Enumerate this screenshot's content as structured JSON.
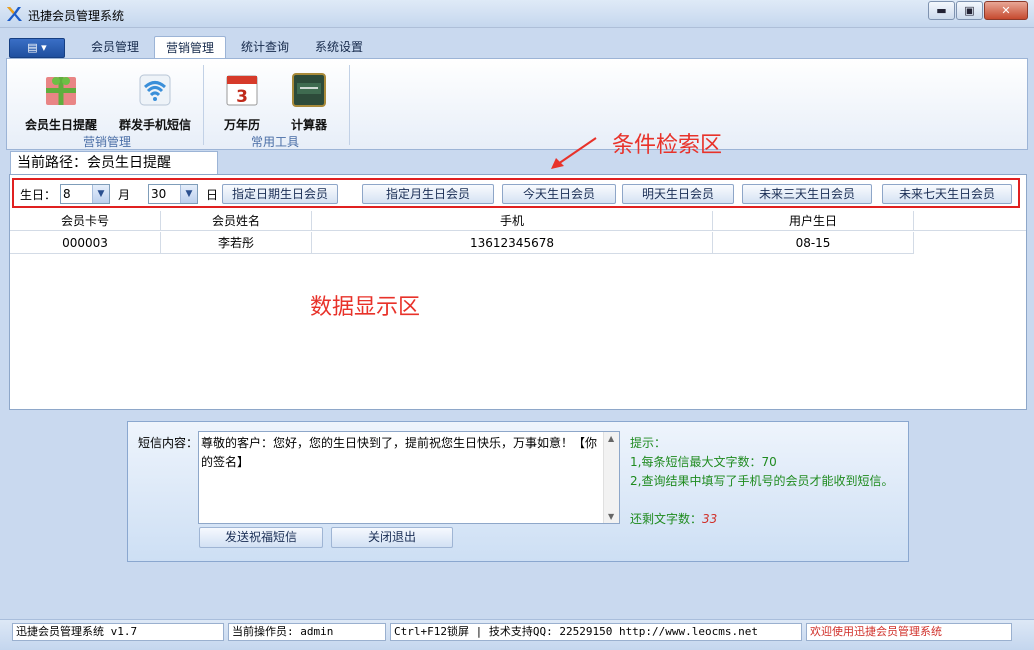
{
  "window": {
    "title": "迅捷会员管理系统",
    "minimize": "▬",
    "maximize": "▣",
    "close": "✕"
  },
  "ribbon": {
    "menu_button": "▤ ▾",
    "tabs": [
      {
        "label": "会员管理"
      },
      {
        "label": "营销管理"
      },
      {
        "label": "统计查询"
      },
      {
        "label": "系统设置"
      }
    ],
    "buttons": [
      {
        "label": "会员生日提醒",
        "icon": "gift-icon"
      },
      {
        "label": "群发手机短信",
        "icon": "wifi-signal-icon"
      },
      {
        "label": "万年历",
        "icon": "calendar-icon"
      },
      {
        "label": "计算器",
        "icon": "calculator-icon"
      }
    ],
    "groups": [
      {
        "label": "营销管理"
      },
      {
        "label": "常用工具"
      }
    ]
  },
  "path": {
    "text": "当前路径：会员生日提醒"
  },
  "search": {
    "birthday_label": "生日：",
    "month_value": "8",
    "month_label": "月",
    "day_value": "30",
    "day_label": "日",
    "buttons": [
      "指定日期生日会员",
      "指定月生日会员",
      "今天生日会员",
      "明天生日会员",
      "未来三天生日会员",
      "未来七天生日会员"
    ]
  },
  "grid": {
    "columns": [
      "会员卡号",
      "会员姓名",
      "手机",
      "用户生日"
    ],
    "rows": [
      [
        "000003",
        "李若彤",
        "13612345678",
        "08-15"
      ]
    ]
  },
  "annotations": {
    "search_area": "条件检索区",
    "data_area": "数据显示区"
  },
  "sms": {
    "label": "短信内容：",
    "content": "尊敬的客户：您好，您的生日快到了，提前祝您生日快乐，万事如意！【你的签名】",
    "send_button": "发送祝福短信",
    "close_button": "关闭退出",
    "tip_title": "提示：",
    "tip_1": "1,每条短信最大文字数：70",
    "tip_2": "2,查询结果中填写了手机号的会员才能收到短信。",
    "remaining_label": "还剩文字数：",
    "remaining_value": "33"
  },
  "status": {
    "app_version": "迅捷会员管理系统 v1.7",
    "operator": "当前操作员: admin",
    "support": "Ctrl+F12锁屏 | 技术支持QQ:  22529150        http://www.leocms.net",
    "welcome": "欢迎使用迅捷会员管理系统"
  },
  "colors": {
    "accent_red": "#e8322a",
    "tip_green": "#1f8b1f",
    "remaining_red": "#d0302a"
  }
}
